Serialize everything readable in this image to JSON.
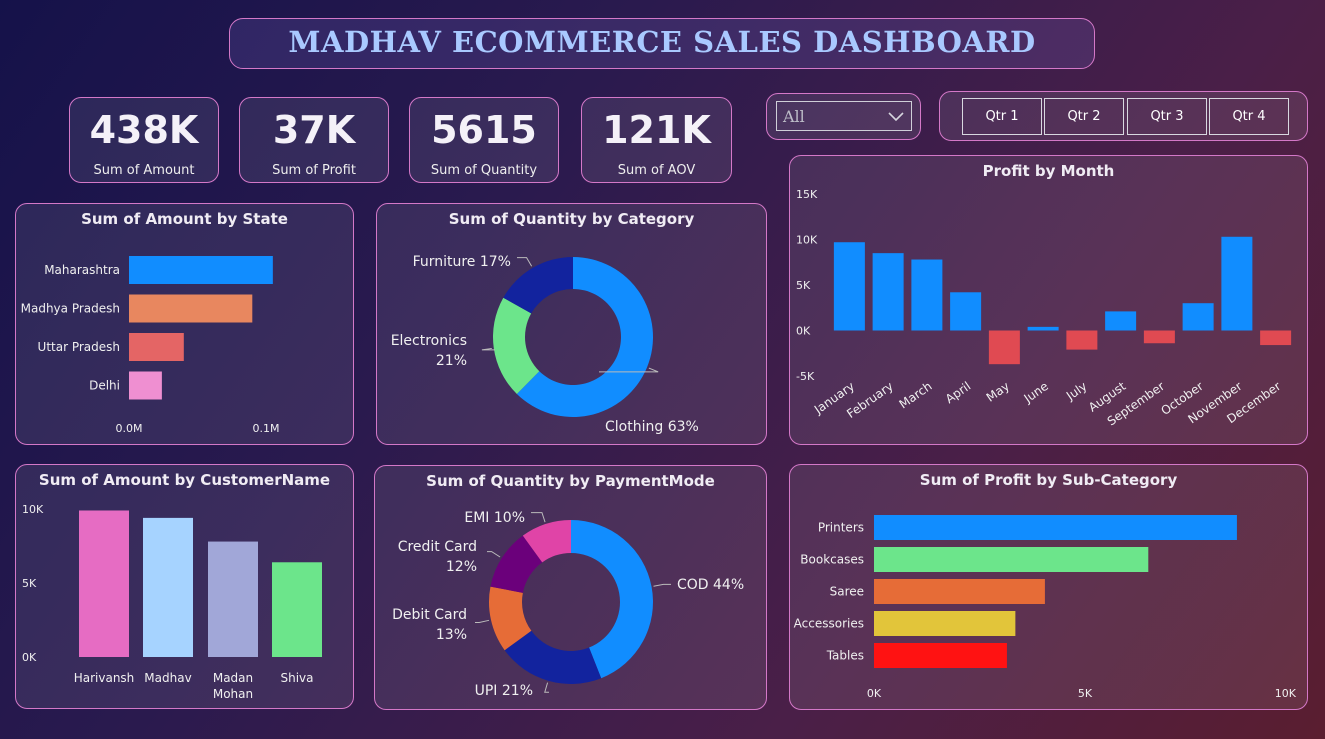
{
  "title": "MADHAV ECOMMERCE SALES DASHBOARD",
  "kpis": [
    {
      "value": "438K",
      "label": "Sum of Amount"
    },
    {
      "value": "37K",
      "label": "Sum of Profit"
    },
    {
      "value": "5615",
      "label": "Sum of Quantity"
    },
    {
      "value": "121K",
      "label": "Sum of AOV"
    }
  ],
  "filters": {
    "state_selected": "All",
    "quarters": [
      "Qtr 1",
      "Qtr 2",
      "Qtr 3",
      "Qtr 4"
    ]
  },
  "chart_data": [
    {
      "id": "amount_by_state",
      "type": "bar",
      "orientation": "horizontal",
      "title": "Sum of Amount by State",
      "categories": [
        "Maharashtra",
        "Madhya Pradesh",
        "Uttar Pradesh",
        "Delhi"
      ],
      "values": [
        0.105,
        0.09,
        0.04,
        0.024
      ],
      "colors": [
        "#118dff",
        "#e8875f",
        "#e46565",
        "#ef8fd1"
      ],
      "xlim": [
        0,
        0.1
      ],
      "ticks": [
        {
          "v": 0,
          "label": "0.0M"
        },
        {
          "v": 0.1,
          "label": "0.1M"
        }
      ]
    },
    {
      "id": "quantity_by_category",
      "type": "pie",
      "donut": true,
      "title": "Sum of Quantity by Category",
      "slices": [
        {
          "name": "Clothing",
          "value": 63,
          "label": "Clothing 63%",
          "color": "#118dff"
        },
        {
          "name": "Electronics",
          "value": 21,
          "label": "Electronics 21%",
          "color": "#6ce58b"
        },
        {
          "name": "Furniture",
          "value": 17,
          "label": "Furniture 17%",
          "color": "#12239e"
        }
      ]
    },
    {
      "id": "profit_by_month",
      "type": "bar",
      "title": "Profit by Month",
      "categories": [
        "January",
        "February",
        "March",
        "April",
        "May",
        "June",
        "July",
        "August",
        "September",
        "October",
        "November",
        "December"
      ],
      "values": [
        9700,
        8500,
        7800,
        4200,
        -3700,
        400,
        -2100,
        2100,
        -1400,
        3000,
        10300,
        -1600
      ],
      "positive_color": "#118dff",
      "negative_color": "#e04a52",
      "ylim": [
        -5000,
        15000
      ],
      "ticks": [
        {
          "v": 15000,
          "label": "15K"
        },
        {
          "v": 10000,
          "label": "10K"
        },
        {
          "v": 5000,
          "label": "5K"
        },
        {
          "v": 0,
          "label": "0K"
        },
        {
          "v": -5000,
          "label": "-5K"
        }
      ]
    },
    {
      "id": "amount_by_customer",
      "type": "bar",
      "title": "Sum of Amount by CustomerName",
      "categories": [
        "Harivansh",
        "Madhav",
        "Madan Mohan",
        "Shiva"
      ],
      "values": [
        9900,
        9400,
        7800,
        6400
      ],
      "colors": [
        "#e66cc3",
        "#a6d3ff",
        "#a1a7d8",
        "#6ce58b"
      ],
      "ylim": [
        0,
        10000
      ],
      "ticks": [
        {
          "v": 10000,
          "label": "10K"
        },
        {
          "v": 5000,
          "label": "5K"
        },
        {
          "v": 0,
          "label": "0K"
        }
      ]
    },
    {
      "id": "quantity_by_paymentmode",
      "type": "pie",
      "donut": true,
      "title": "Sum of Quantity by PaymentMode",
      "slices": [
        {
          "name": "COD",
          "value": 44,
          "label": "COD 44%",
          "color": "#118dff"
        },
        {
          "name": "UPI",
          "value": 21,
          "label": "UPI 21%",
          "color": "#12239e"
        },
        {
          "name": "Debit Card",
          "value": 13,
          "label": "Debit Card 13%",
          "color": "#e66c37"
        },
        {
          "name": "Credit Card",
          "value": 12,
          "label": "Credit Card 12%",
          "color": "#6b007b"
        },
        {
          "name": "EMI",
          "value": 10,
          "label": "EMI 10%",
          "color": "#e044a7"
        }
      ]
    },
    {
      "id": "profit_by_subcategory",
      "type": "bar",
      "orientation": "horizontal",
      "title": "Sum of Profit by Sub-Category",
      "categories": [
        "Printers",
        "Bookcases",
        "Saree",
        "Accessories",
        "Tables"
      ],
      "values": [
        8600,
        6500,
        4050,
        3350,
        3150
      ],
      "colors": [
        "#118dff",
        "#6ce58b",
        "#e66c37",
        "#e2c53a",
        "#ff1212"
      ],
      "xlim": [
        0,
        10000
      ],
      "ticks": [
        {
          "v": 0,
          "label": "0K"
        },
        {
          "v": 5000,
          "label": "5K"
        },
        {
          "v": 10000,
          "label": "10K"
        }
      ]
    }
  ]
}
